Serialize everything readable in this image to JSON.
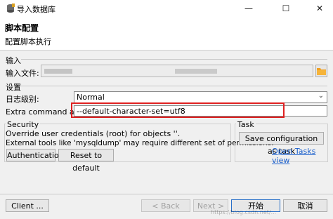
{
  "window": {
    "title": "导入数据库",
    "minimize": "—",
    "maximize": "☐",
    "close": "✕"
  },
  "header": {
    "title": "脚本配置",
    "subtitle": "配置脚本执行"
  },
  "input_section": {
    "label": "输入",
    "file_label": "输入文件:",
    "file_value": "",
    "folder_icon": "folder-icon"
  },
  "settings_section": {
    "label": "设置",
    "log_level_label": "日志级别:",
    "log_level_value": "Normal",
    "extra_args_label": "Extra command args:",
    "extra_args_value": "--default-character-set=utf8"
  },
  "security": {
    "label": "Security",
    "line1": "Override user credentials (root) for objects ''.",
    "line2": "External tools like 'mysqldump' may require different set of permissions.",
    "auth_button": "Authentication",
    "reset_button": "Reset to default"
  },
  "task": {
    "label": "Task",
    "save_button": "Save configuration as task",
    "open_link": "Open Tasks view"
  },
  "footer": {
    "client_button": "Client ...",
    "back_button": "< Back",
    "next_button": "Next >",
    "start_button": "开始",
    "cancel_button": "取消",
    "watermark": "https://blog.csdn.net/..."
  },
  "colors": {
    "highlight": "#e02020",
    "link": "#1a5fcc",
    "folder": "#f0a020"
  }
}
